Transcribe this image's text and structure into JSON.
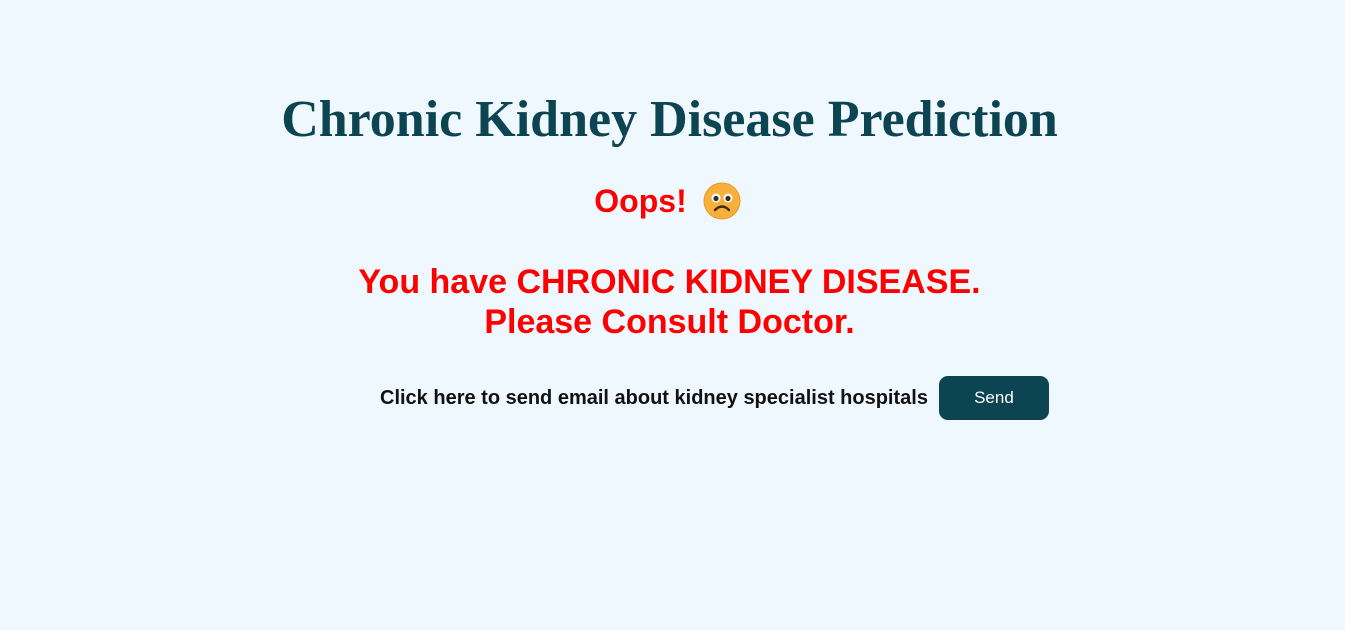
{
  "header": {
    "title": "Chronic Kidney Disease Prediction"
  },
  "result": {
    "exclamation": "Oops!",
    "emoji_icon": "sad-face-icon",
    "line1": "You have CHRONIC KIDNEY DISEASE.",
    "line2": "Please Consult Doctor."
  },
  "email": {
    "label": "Click here to send email about kidney specialist hospitals",
    "button_label": "Send"
  },
  "colors": {
    "background": "#f0f8ff",
    "title": "#0d4451",
    "alert": "#ff0000",
    "button": "#0d4451"
  }
}
